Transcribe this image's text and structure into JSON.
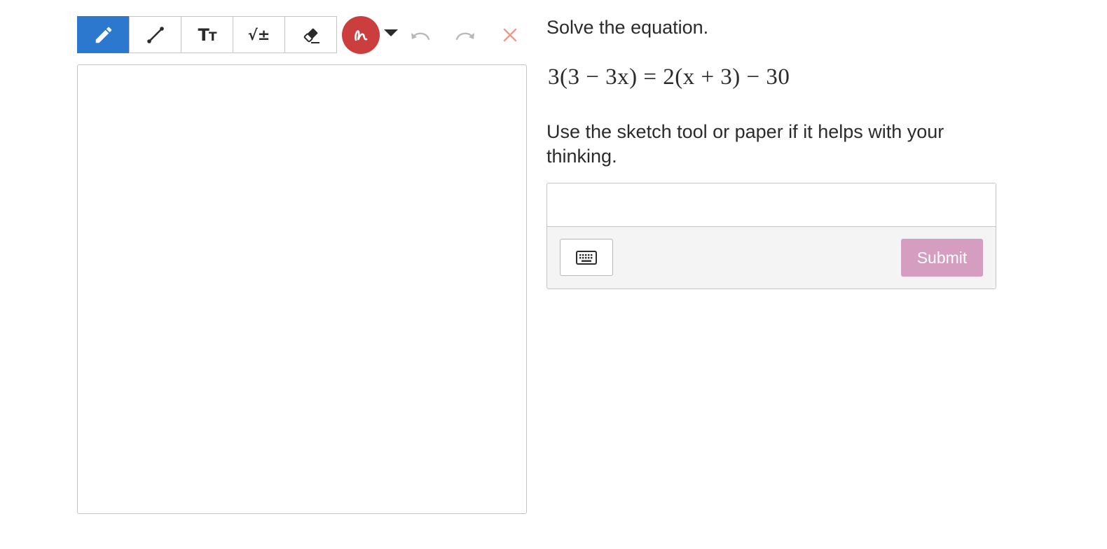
{
  "toolbar": {
    "tools": [
      {
        "name": "pencil-icon",
        "active": true
      },
      {
        "name": "line-icon",
        "active": false
      },
      {
        "name": "text-size-icon",
        "label": "TT",
        "active": false
      },
      {
        "name": "math-icon",
        "label": "√±",
        "active": false
      },
      {
        "name": "eraser-icon",
        "active": false
      }
    ],
    "color_icon": "squiggle-icon",
    "selected_color": "#cc3d3d",
    "active_color": "#2d78cf",
    "caret_icon": "caret-down-icon",
    "undo_icon": "undo-icon",
    "redo_icon": "redo-icon",
    "clear_icon": "close-icon",
    "clear_color": "#ee9a88"
  },
  "question": {
    "prompt": "Solve the equation.",
    "equation": "3(3 − 3x) = 2(x + 3) − 30",
    "instructions": "Use the sketch tool or paper if it helps with your thinking."
  },
  "answer": {
    "value": "",
    "keyboard_icon": "keyboard-icon",
    "submit_label": "Submit",
    "submit_color": "#d59dc0"
  }
}
